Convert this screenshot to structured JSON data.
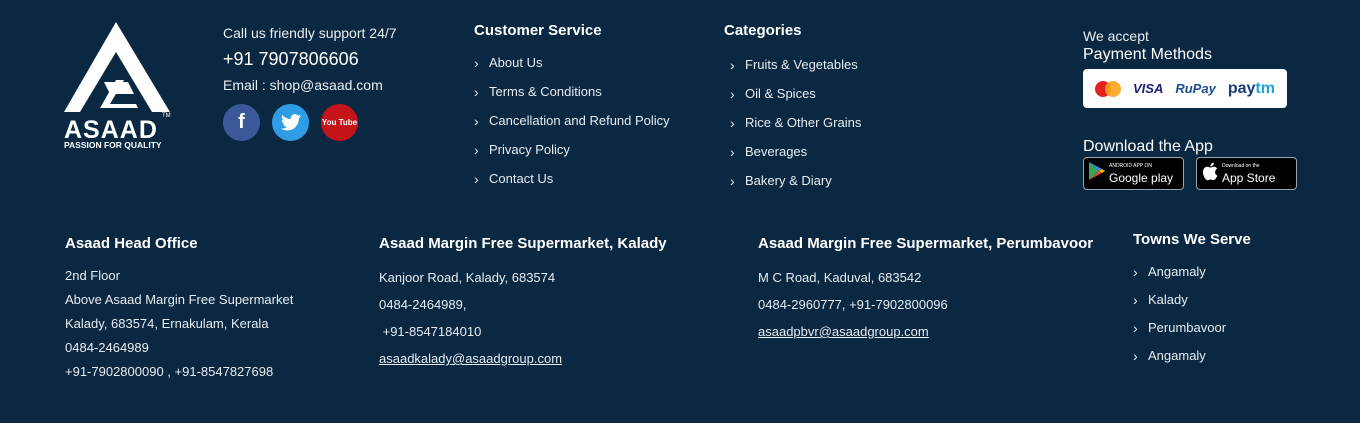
{
  "brand": {
    "name": "ASAAD",
    "tagline": "PASSION FOR QUALITY",
    "tm": "TM"
  },
  "contact": {
    "support": "Call us friendly support 24/7",
    "phone": "+91 7907806606",
    "email": "Email : shop@asaad.com",
    "socials": [
      {
        "icon": "facebook-icon",
        "glyph": "f"
      },
      {
        "icon": "twitter-icon",
        "glyph": "t"
      },
      {
        "icon": "youtube-icon",
        "glyph": "You Tube"
      }
    ]
  },
  "customer_service": {
    "title": "Customer Service",
    "links": [
      "About Us",
      "Terms & Conditions",
      "Cancellation and Refund Policy",
      "Privacy Policy",
      "Contact Us"
    ]
  },
  "categories": {
    "title": "Categories",
    "links": [
      "Fruits & Vegetables",
      "Oil & Spices",
      "Rice & Other Grains",
      "Beverages",
      "Bakery & Diary"
    ]
  },
  "payment": {
    "accept": "We accept",
    "methods_title": "Payment Methods",
    "methods": [
      "MasterCard",
      "VISA",
      "RuPay",
      "Paytm"
    ]
  },
  "app": {
    "title": "Download the App",
    "google_small": "ANDROID APP ON",
    "google_big": "Google play",
    "apple_small": "Download on the",
    "apple_big": "App Store"
  },
  "offices": [
    {
      "title": "Asaad Head Office",
      "lines": [
        "2nd Floor",
        "Above Asaad Margin Free Supermarket",
        "Kalady, 683574, Ernakulam, Kerala",
        "0484-2464989",
        "+91-7902800090 ,  +91-8547827698"
      ]
    },
    {
      "title": "Asaad Margin Free Supermarket, Kalady",
      "lines": [
        "Kanjoor Road, Kalady, 683574",
        "0484-2464989,",
        " +91-8547184010"
      ],
      "email": "asaadkalady@asaadgroup.com"
    },
    {
      "title": "Asaad Margin Free Supermarket, Perumbavoor",
      "lines": [
        "M C Road, Kaduval, 683542",
        "0484-2960777, +91-7902800096"
      ],
      "email": "asaadpbvr@asaadgroup.com"
    }
  ],
  "towns": {
    "title": "Towns We Serve",
    "items": [
      "Angamaly",
      "Kalady",
      "Perumbavoor",
      "Angamaly"
    ]
  },
  "colors": {
    "background": "#0a2841",
    "facebook": "#3b5998",
    "twitter": "#2f9de6",
    "youtube": "#c4141a"
  }
}
